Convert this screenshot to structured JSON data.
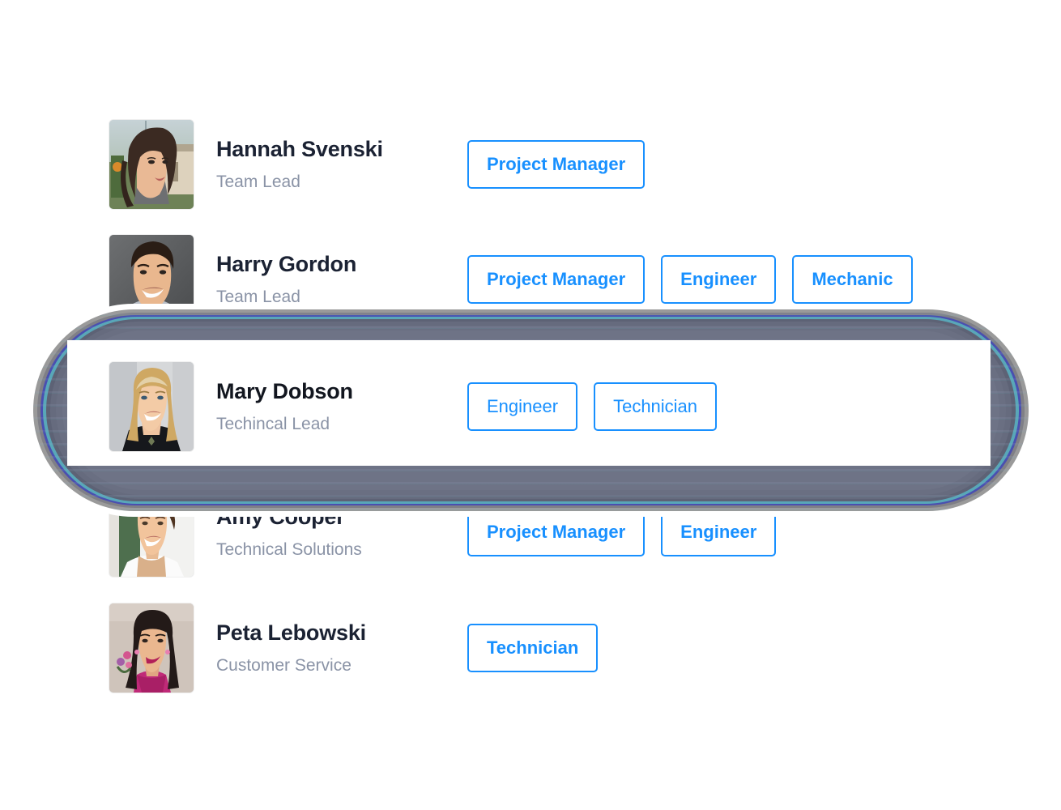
{
  "theme": {
    "accent_color": "#1890ff",
    "name_color": "#1b2233",
    "role_color": "#8a93a6",
    "card_background": "#ffffff",
    "scrim_color": "#6e7386",
    "page_background": "#ffffff"
  },
  "list": {
    "name": "team-roster",
    "rows": [
      {
        "id": "hannah-svenski",
        "name": "Hannah Svenski",
        "role": "Team Lead",
        "avatar_alt": "portrait-hannah-svenski",
        "badges": [
          "Project Manager"
        ],
        "focused": false
      },
      {
        "id": "harry-gordon",
        "name": "Harry Gordon",
        "role": "Team Lead",
        "avatar_alt": "portrait-harry-gordon",
        "badges": [
          "Project Manager",
          "Engineer",
          "Mechanic"
        ],
        "focused": false
      },
      {
        "id": "mary-dobson",
        "name": "Mary Dobson",
        "role": "Techincal Lead",
        "avatar_alt": "portrait-mary-dobson",
        "badges": [
          "Engineer",
          "Technician"
        ],
        "focused": true
      },
      {
        "id": "amy-cooper",
        "name": "Amy Cooper",
        "role": "Technical Solutions",
        "avatar_alt": "portrait-amy-cooper",
        "badges": [
          "Project Manager",
          "Engineer"
        ],
        "focused": false
      },
      {
        "id": "peta-lebowski",
        "name": "Peta Lebowski",
        "role": "Customer Service",
        "avatar_alt": "portrait-peta-lebowski",
        "badges": [
          "Technician"
        ],
        "focused": false
      }
    ]
  },
  "spotlight": {
    "name": "focus-highlight-ring",
    "target_row": "mary-dobson",
    "ring_colors": [
      "#9a9a9a",
      "#7f7f86",
      "#4a4fb0",
      "#59a7b8",
      "#5d6275",
      "#666b7e",
      "#6a6f82",
      "#6e7386"
    ]
  },
  "focus_card": {
    "name": "Mary Dobson",
    "role": "Techincal Lead",
    "badges": [
      "Engineer",
      "Technician"
    ],
    "avatar_alt": "portrait-mary-dobson"
  }
}
